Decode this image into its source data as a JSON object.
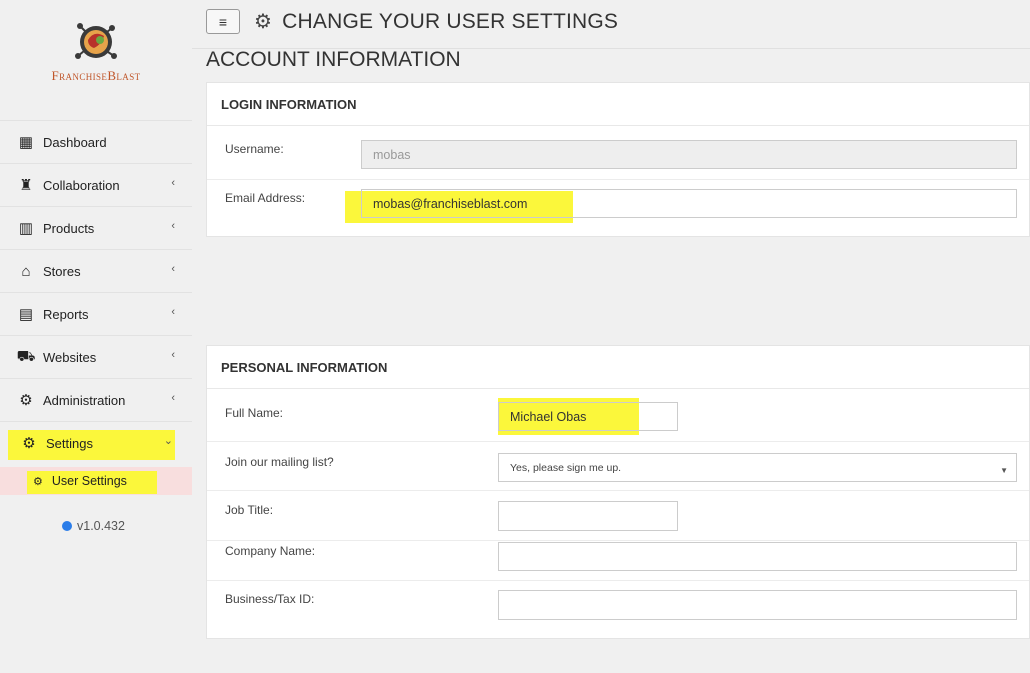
{
  "logo": {
    "text_a": "Franchise",
    "text_b": "Blast"
  },
  "sidebar": {
    "items": [
      {
        "label": "Dashboard",
        "icon": "grid-icon",
        "glyph": "▦"
      },
      {
        "label": "Collaboration",
        "icon": "person-icon",
        "glyph": "♜"
      },
      {
        "label": "Products",
        "icon": "barcode-icon",
        "glyph": "▥"
      },
      {
        "label": "Stores",
        "icon": "bank-icon",
        "glyph": "⌂"
      },
      {
        "label": "Reports",
        "icon": "calculator-icon",
        "glyph": "▤"
      },
      {
        "label": "Websites",
        "icon": "cart-icon",
        "glyph": "⛟"
      },
      {
        "label": "Administration",
        "icon": "cogs-icon",
        "glyph": "⚙"
      },
      {
        "label": "Settings",
        "icon": "gear-icon",
        "glyph": "⚙"
      }
    ],
    "sub_item": {
      "label": "User Settings",
      "glyph": "⚙"
    },
    "version": "v1.0.432"
  },
  "header": {
    "menu_glyph": "≡",
    "title_glyph": "⚙",
    "title": "CHANGE YOUR USER SETTINGS"
  },
  "section_title": "ACCOUNT INFORMATION",
  "login": {
    "heading": "LOGIN INFORMATION",
    "username_label": "Username:",
    "username_value": "mobas",
    "email_label": "Email Address:",
    "email_value": "mobas@franchiseblast.com"
  },
  "personal": {
    "heading": "PERSONAL INFORMATION",
    "fullname_label": "Full Name:",
    "fullname_value": "Michael Obas",
    "mailing_label": "Join our mailing list?",
    "mailing_value": "Yes, please sign me up.",
    "jobtitle_label": "Job Title:",
    "jobtitle_value": "",
    "company_label": "Company Name:",
    "company_value": "",
    "taxid_label": "Business/Tax ID:",
    "taxid_value": ""
  },
  "colors": {
    "highlight": "#fbf73b",
    "accent": "#c0562a",
    "version_dot": "#2b7de9"
  }
}
